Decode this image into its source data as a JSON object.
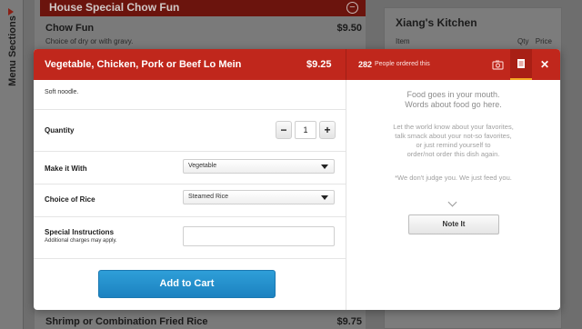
{
  "background": {
    "sidebar_label": "Menu Sections",
    "section_title": "House Special Chow Fun",
    "first_item": {
      "name": "Chow Fun",
      "price": "$9.50",
      "description": "Choice of dry or with gravy."
    },
    "order_panel": {
      "title": "Xiang's Kitchen",
      "col_item": "Item",
      "col_qty": "Qty",
      "col_price": "Price"
    },
    "bottom_item": {
      "name": "Shrimp or Combination Fried Rice",
      "price": "$9.75"
    }
  },
  "modal": {
    "header": {
      "item_name": "Vegetable, Chicken, Pork or Beef Lo Mein",
      "price": "$9.25",
      "order_count": "282",
      "order_count_label": "People ordered this",
      "close_label": "✕",
      "photo_tab_icon": "camera-icon",
      "note_tab_icon": "note-icon"
    },
    "description": "Soft noodle.",
    "quantity": {
      "label": "Quantity",
      "minus": "−",
      "value": "1",
      "plus": "+"
    },
    "make_it_with": {
      "label": "Make it With",
      "selected": "Vegetable"
    },
    "choice_of_rice": {
      "label": "Choice of Rice",
      "selected": "Steamed Rice"
    },
    "special_instructions": {
      "label": "Special Instructions",
      "sublabel": "Additional charges may apply.",
      "value": "",
      "placeholder": ""
    },
    "add_to_cart_label": "Add to Cart",
    "notes": {
      "heading_line1": "Food goes in your mouth.",
      "heading_line2": "Words about food go here.",
      "body_line1": "Let the world know about your favorites,",
      "body_line2": "talk smack about your not-so favorites,",
      "body_line3": "or just remind yourself to",
      "body_line4": "order/not order this dish again.",
      "tagline": "*We don't judge you. We just feed you.",
      "button_label": "Note It"
    }
  },
  "colors": {
    "header_red": "#c0271c",
    "accent_orange": "#f2a623",
    "cart_blue": "#1f88c6"
  }
}
